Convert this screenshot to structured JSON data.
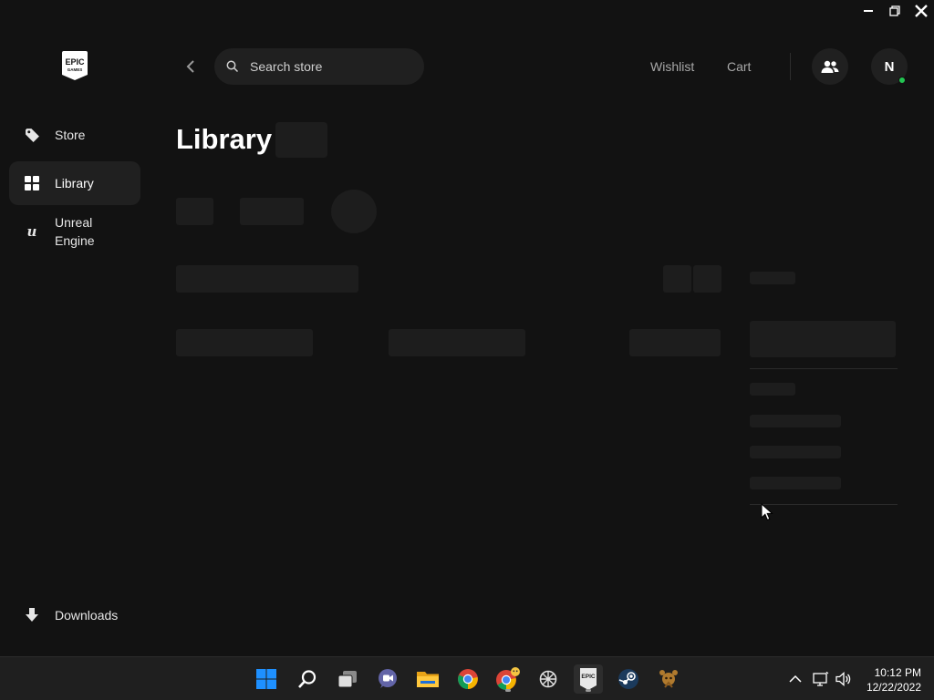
{
  "window_controls": {
    "minimize_icon": "minimize-icon",
    "restore_icon": "restore-icon",
    "close_icon": "close-icon"
  },
  "sidebar": {
    "logo_text": [
      "EPIC",
      "GAMES"
    ],
    "items": [
      {
        "label": "Store",
        "icon": "tag-icon",
        "active": false
      },
      {
        "label": "Library",
        "icon": "grid-icon",
        "active": true
      },
      {
        "label": "Unreal Engine",
        "label_lines": [
          "Unreal",
          "Engine"
        ],
        "icon": "unreal-icon",
        "active": false
      }
    ],
    "downloads_label": "Downloads",
    "downloads_icon": "download-arrow-icon"
  },
  "topbar": {
    "search_placeholder": "Search store",
    "wishlist_label": "Wishlist",
    "cart_label": "Cart",
    "friends_icon": "friends-icon",
    "avatar_initial": "N",
    "online_color": "#23c552"
  },
  "main": {
    "title": "Library"
  },
  "taskbar": {
    "apps": [
      "windows-start",
      "search",
      "task-view",
      "teams-chat",
      "file-explorer",
      "chrome",
      "chrome-beta",
      "perplexity",
      "epic-games-launcher",
      "steam",
      "game-app"
    ],
    "active_app": "epic-games-launcher",
    "time": "10:12 PM",
    "date": "12/22/2022"
  },
  "colors": {
    "background": "#121212",
    "panel": "#202020",
    "skeleton": "#1d1d1d",
    "taskbar": "#1f1f1f"
  }
}
